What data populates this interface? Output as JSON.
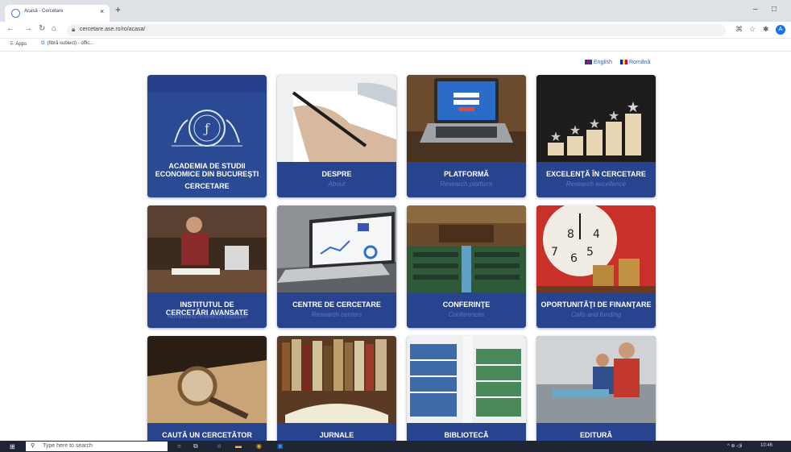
{
  "browser": {
    "tab_title": "Acasă - Cercetare",
    "tab_close": "×",
    "new_tab": "+",
    "minimize": "–",
    "restore": "□",
    "url": "cercetare.ase.ro/ro/acasa/",
    "profile_initial": "A",
    "bookmarks": [
      {
        "icon": "apps-icon",
        "label": "Apps"
      },
      {
        "icon": "google-icon",
        "label": "(fibrã subiect) - offic..."
      }
    ]
  },
  "language": {
    "english": "English",
    "romanian": "Română"
  },
  "cards": [
    {
      "title_lines": [
        "ACADEMIA DE STUDII",
        "ECONOMICE DIN BUCUREŞTI",
        "CERCETARE"
      ],
      "subtitle": "",
      "image": "ase-logo-image"
    },
    {
      "title_lines": [
        "DESPRE"
      ],
      "subtitle": "About",
      "image": "writing-pen-image"
    },
    {
      "title_lines": [
        "PLATFORMĂ"
      ],
      "subtitle": "Research platform",
      "image": "laptop-login-image"
    },
    {
      "title_lines": [
        "EXCELENŢĂ ÎN CERCETARE"
      ],
      "subtitle": "Research excellence",
      "image": "stars-blocks-image"
    },
    {
      "title_lines": [
        "INSTITUTUL DE",
        "CERCETĂRI AVANSATE"
      ],
      "subtitle": "Advanced research institute",
      "image": "library-student-image"
    },
    {
      "title_lines": [
        "CENTRE DE CERCETARE"
      ],
      "subtitle": "Research centers",
      "image": "laptop-charts-image"
    },
    {
      "title_lines": [
        "CONFERINŢE"
      ],
      "subtitle": "Conferences",
      "image": "conference-hall-image"
    },
    {
      "title_lines": [
        "OPORTUNITĂŢI DE FINANŢARE"
      ],
      "subtitle": "Calls and funding",
      "image": "clock-coins-image"
    },
    {
      "title_lines": [
        "CAUTĂ UN CERCETĂTOR"
      ],
      "subtitle": "",
      "image": "magnifying-glass-image"
    },
    {
      "title_lines": [
        "JURNALE"
      ],
      "subtitle": "",
      "image": "books-image"
    },
    {
      "title_lines": [
        "BIBLIOTECĂ"
      ],
      "subtitle": "",
      "image": "bookshelves-image"
    },
    {
      "title_lines": [
        "EDITURĂ"
      ],
      "subtitle": "",
      "image": "print-workers-image"
    }
  ],
  "taskbar": {
    "search_placeholder": "Type here to search",
    "time": "10:46"
  },
  "colors": {
    "card_blue": "#28448f",
    "subtitle_blue": "#5e78c0",
    "link_blue": "#3a5fb6"
  }
}
